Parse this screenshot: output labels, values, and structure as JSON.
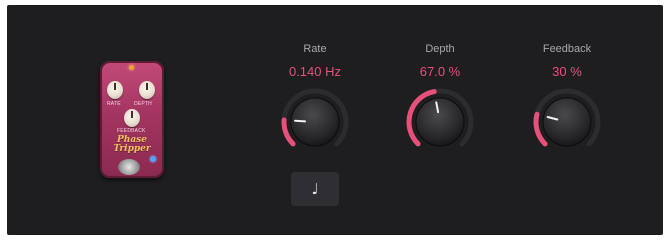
{
  "pedal": {
    "knob_labels": [
      "RATE",
      "DEPTH",
      "FEEDBACK"
    ],
    "name_line1": "Phase",
    "name_line2": "Tripper"
  },
  "knobs": [
    {
      "label": "Rate",
      "value": "0.140 Hz",
      "fraction": 0.18
    },
    {
      "label": "Depth",
      "value": "67.0 %",
      "fraction": 0.46
    },
    {
      "label": "Feedback",
      "value": "30 %",
      "fraction": 0.22
    }
  ],
  "sync_icon": "♩",
  "colors": {
    "accent": "#e6507a",
    "knob_track": "#2c2c30",
    "panel_bg": "#1e1e20"
  }
}
